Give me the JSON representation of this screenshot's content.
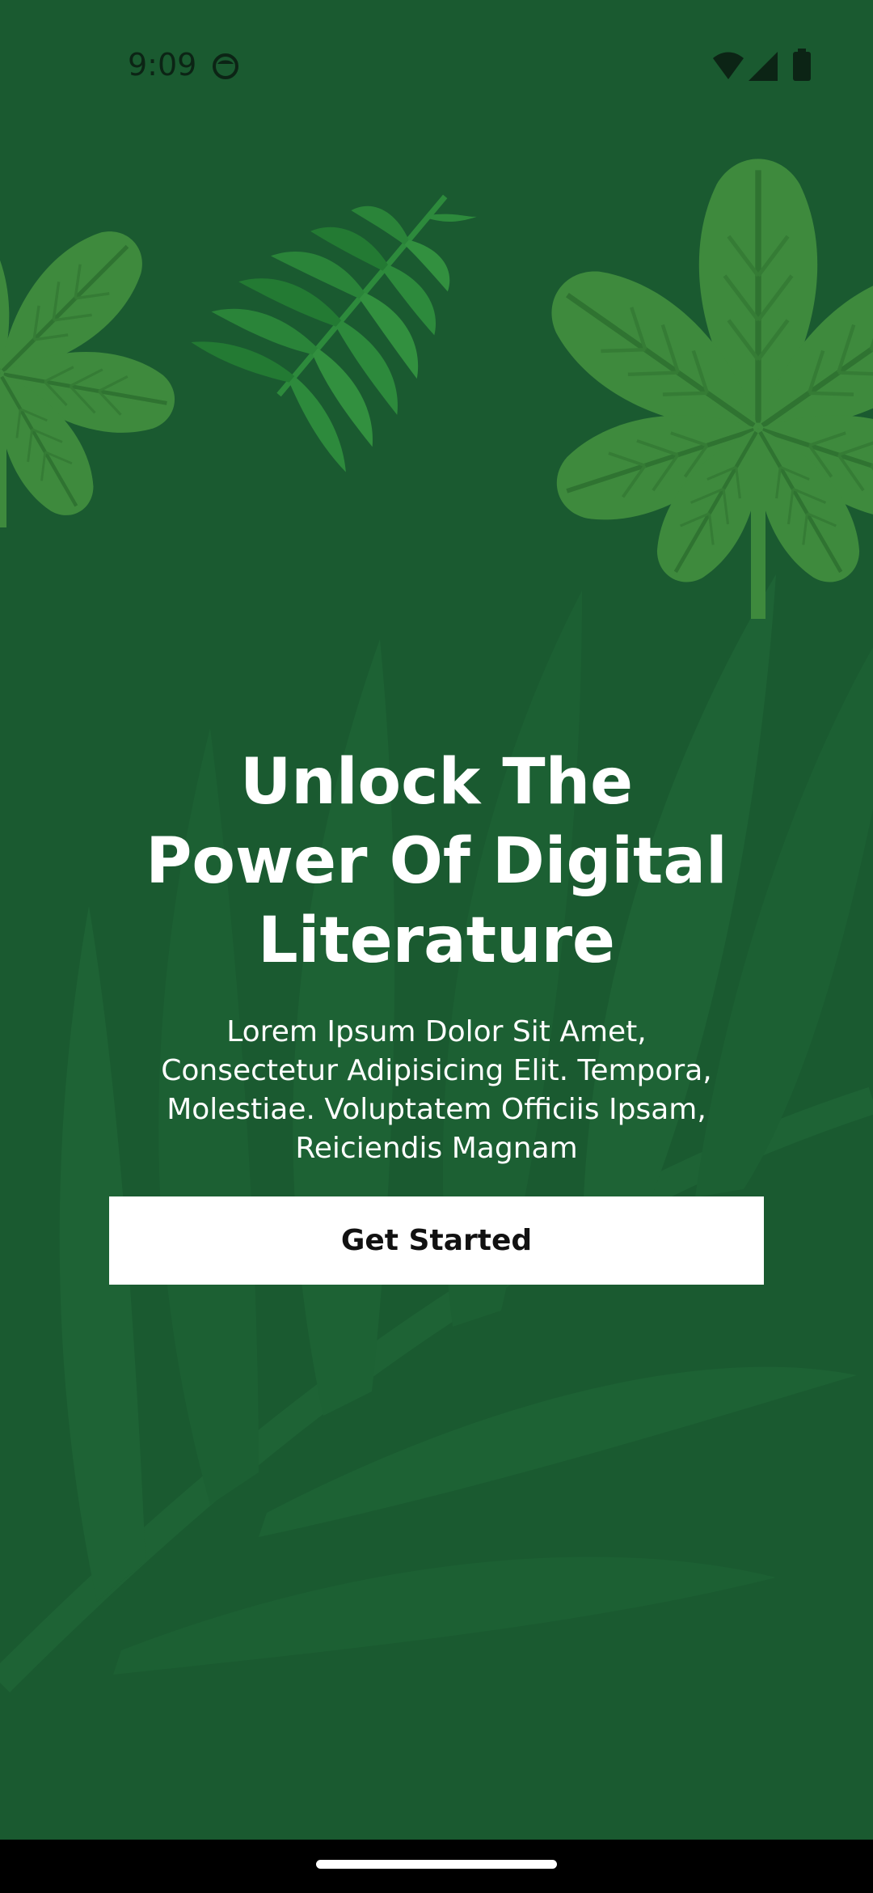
{
  "status_bar": {
    "time": "9:09",
    "icons": [
      "face-notification-icon",
      "wifi-icon",
      "cell-signal-icon",
      "battery-icon"
    ]
  },
  "onboarding": {
    "headline_lines": [
      "Unlock The",
      "Power Of Digital",
      "Literature"
    ],
    "description_lines": [
      "Lorem Ipsum Dolor Sit Amet,",
      "Consectetur Adipisicing Elit. Tempora,",
      "Molestiae. Voluptatem Officiis Ipsam,",
      "Reiciendis Magnam"
    ],
    "cta_label": "Get Started"
  },
  "decor": {
    "icons": [
      "chestnut-leaf-left-icon",
      "fern-leaf-icon",
      "chestnut-leaf-right-icon",
      "background-palm-leaf-icon"
    ]
  },
  "colors": {
    "background": "#1a5a30",
    "leaf": "#3e8a3d",
    "leaf_vein": "#2f7331",
    "fern": "#2d8a3c",
    "text": "#ffffff",
    "button": "#ffffff",
    "button_text": "#111111",
    "nav_bar": "#000000"
  }
}
